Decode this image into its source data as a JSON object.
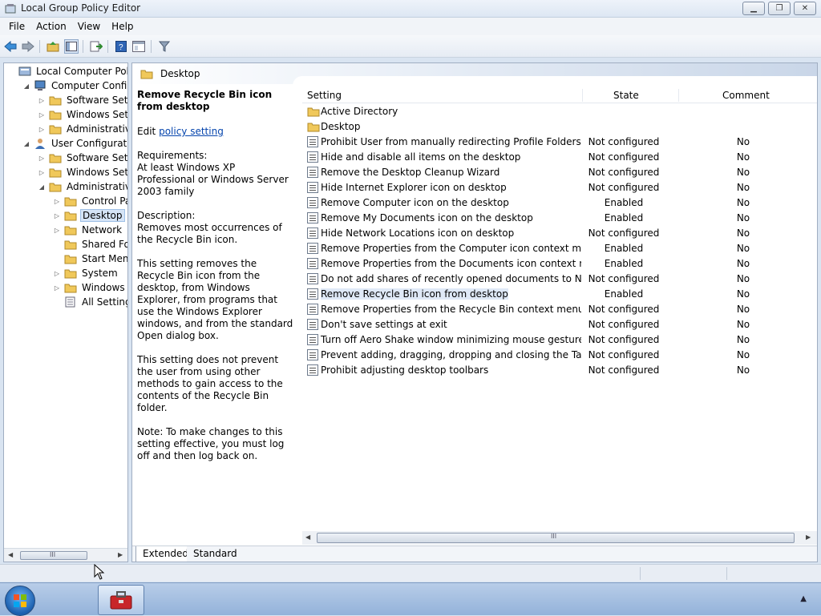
{
  "window": {
    "title": "Local Group Policy Editor",
    "buttons": {
      "minimize": "▁",
      "maximize": "❐",
      "close": "✕"
    }
  },
  "menu": [
    "File",
    "Action",
    "View",
    "Help"
  ],
  "toolbar": {
    "icons": [
      "back-arrow-icon",
      "forward-arrow-icon",
      "up-folder-icon",
      "show-hide-tree-icon",
      "export-list-icon",
      "help-icon",
      "properties-icon",
      "filter-icon"
    ]
  },
  "tree": {
    "items": [
      {
        "label": "Local Computer Policy",
        "icon": "policy-computer-icon",
        "expander": ""
      },
      {
        "label": "Computer Configura",
        "icon": "computer-icon",
        "expander": "◢"
      },
      {
        "label": "Software Settings",
        "icon": "folder-icon",
        "expander": "▷"
      },
      {
        "label": "Windows Setting",
        "icon": "folder-icon",
        "expander": "▷"
      },
      {
        "label": "Administrative Te",
        "icon": "folder-icon",
        "expander": "▷"
      },
      {
        "label": "User Configuration",
        "icon": "user-icon",
        "expander": "◢"
      },
      {
        "label": "Software Settings",
        "icon": "folder-icon",
        "expander": "▷"
      },
      {
        "label": "Windows Setting",
        "icon": "folder-icon",
        "expander": "▷"
      },
      {
        "label": "Administrative Te",
        "icon": "folder-icon",
        "expander": "◢"
      },
      {
        "label": "Control Panel",
        "icon": "folder-icon",
        "expander": "▷"
      },
      {
        "label": "Desktop",
        "icon": "folder-icon",
        "expander": "▷"
      },
      {
        "label": "Network",
        "icon": "folder-icon",
        "expander": "▷"
      },
      {
        "label": "Shared Folder",
        "icon": "folder-icon",
        "expander": ""
      },
      {
        "label": "Start Menu ar",
        "icon": "folder-icon",
        "expander": ""
      },
      {
        "label": "System",
        "icon": "folder-icon",
        "expander": "▷"
      },
      {
        "label": "Windows Cor",
        "icon": "folder-icon",
        "expander": "▷"
      },
      {
        "label": "All Settings",
        "icon": "all-settings-icon",
        "expander": ""
      }
    ],
    "scroll_grip": "III"
  },
  "pane": {
    "header": "Desktop",
    "description": {
      "heading": "Remove Recycle Bin icon from desktop",
      "edit_prefix": "Edit",
      "edit_link": "policy setting",
      "requirements_label": "Requirements:",
      "requirements": "At least Windows XP Professional or Windows Server 2003 family",
      "description_label": "Description:",
      "description": "Removes most occurrences of the Recycle Bin icon.",
      "para1": "This setting removes the Recycle Bin icon from the desktop, from Windows Explorer, from programs that use the Windows Explorer windows, and from the standard Open dialog box.",
      "para2": "This setting does not prevent the user from using other methods to gain access to the contents of the Recycle Bin folder.",
      "note": "Note: To make changes to this setting effective, you must log off and then log back on."
    },
    "columns": {
      "setting": "Setting",
      "state": "State",
      "comment": "Comment"
    },
    "rows": [
      {
        "setting": "Active Directory",
        "state": "",
        "comment": "",
        "type": "folder"
      },
      {
        "setting": "Desktop",
        "state": "",
        "comment": "",
        "type": "folder"
      },
      {
        "setting": "Prohibit User from manually redirecting Profile Folders",
        "state": "Not configured",
        "comment": "No",
        "type": "policy"
      },
      {
        "setting": "Hide and disable all items on the desktop",
        "state": "Not configured",
        "comment": "No",
        "type": "policy"
      },
      {
        "setting": "Remove the Desktop Cleanup Wizard",
        "state": "Not configured",
        "comment": "No",
        "type": "policy"
      },
      {
        "setting": "Hide Internet Explorer icon on desktop",
        "state": "Not configured",
        "comment": "No",
        "type": "policy"
      },
      {
        "setting": "Remove Computer icon on the desktop",
        "state": "Enabled",
        "comment": "No",
        "type": "policy"
      },
      {
        "setting": "Remove My Documents icon on the desktop",
        "state": "Enabled",
        "comment": "No",
        "type": "policy"
      },
      {
        "setting": "Hide Network Locations icon on desktop",
        "state": "Not configured",
        "comment": "No",
        "type": "policy"
      },
      {
        "setting": "Remove Properties from the Computer icon context menu",
        "state": "Enabled",
        "comment": "No",
        "type": "policy"
      },
      {
        "setting": "Remove Properties from the Documents icon context menu",
        "state": "Enabled",
        "comment": "No",
        "type": "policy"
      },
      {
        "setting": "Do not add shares of recently opened documents to Networ...",
        "state": "Not configured",
        "comment": "No",
        "type": "policy"
      },
      {
        "setting": "Remove Recycle Bin icon from desktop",
        "state": "Enabled",
        "comment": "No",
        "type": "policy"
      },
      {
        "setting": "Remove Properties from the Recycle Bin context menu",
        "state": "Not configured",
        "comment": "No",
        "type": "policy"
      },
      {
        "setting": "Don't save settings at exit",
        "state": "Not configured",
        "comment": "No",
        "type": "policy"
      },
      {
        "setting": "Turn off Aero Shake window minimizing mouse gesture",
        "state": "Not configured",
        "comment": "No",
        "type": "policy"
      },
      {
        "setting": "Prevent adding, dragging, dropping and closing the Taskbar...",
        "state": "Not configured",
        "comment": "No",
        "type": "policy"
      },
      {
        "setting": "Prohibit adjusting desktop toolbars",
        "state": "Not configured",
        "comment": "No",
        "type": "policy"
      }
    ],
    "selected_row": "Remove Recycle Bin icon from desktop",
    "scroll_grip": "III",
    "tabs": [
      "Extended",
      "Standard"
    ]
  },
  "taskbar": {
    "start": "windows-start-orb-icon",
    "app": "group-policy-toolbox-icon",
    "tray_arrow": "▲"
  },
  "colors": {
    "selection": "#d5e4f6",
    "link": "#0645ad",
    "folder": "#f0c85a"
  }
}
